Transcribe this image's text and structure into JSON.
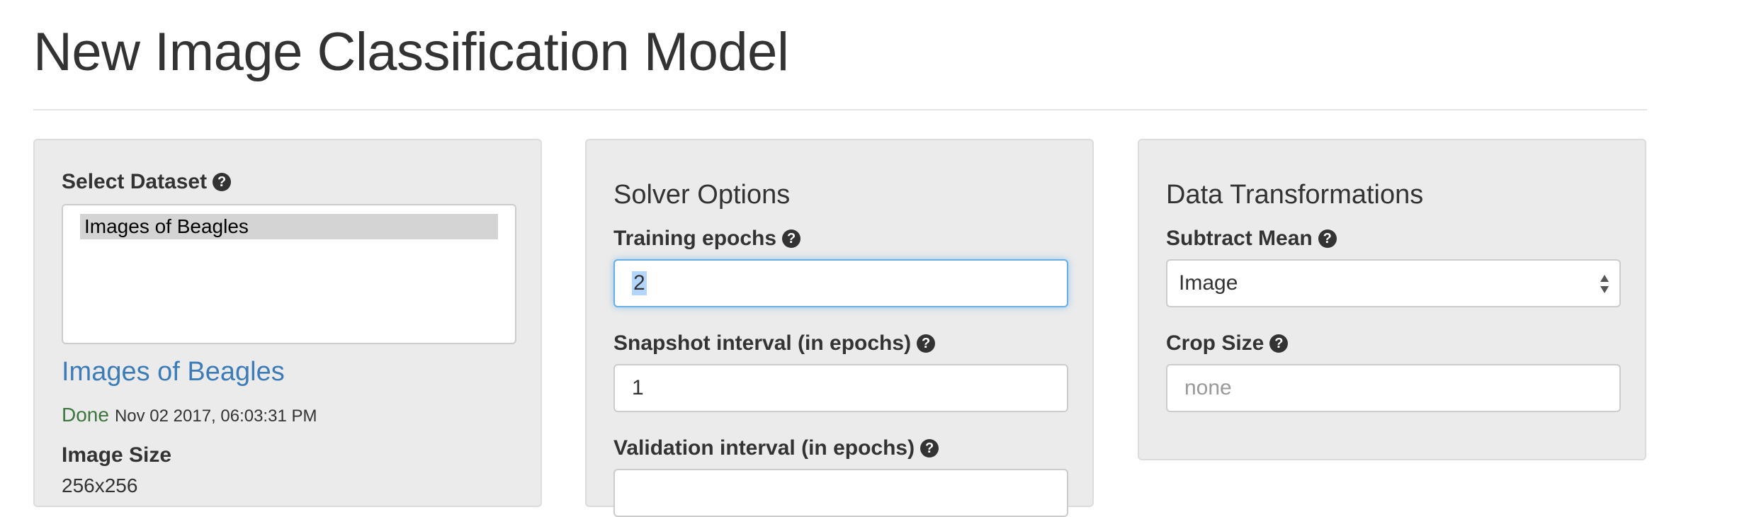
{
  "page": {
    "title": "New Image Classification Model"
  },
  "dataset_panel": {
    "select_label": "Select Dataset",
    "options": [
      "Images of Beagles"
    ],
    "selected_name": "Images of Beagles",
    "status": "Done",
    "timestamp": "Nov 02 2017, 06:03:31 PM",
    "image_size_label": "Image Size",
    "image_size_value": "256x256"
  },
  "solver_panel": {
    "heading": "Solver Options",
    "training_epochs_label": "Training epochs",
    "training_epochs_value": "2",
    "snapshot_label": "Snapshot interval (in epochs)",
    "snapshot_value": "1",
    "validation_label": "Validation interval (in epochs)"
  },
  "transform_panel": {
    "heading": "Data Transformations",
    "subtract_mean_label": "Subtract Mean",
    "subtract_mean_value": "Image",
    "crop_size_label": "Crop Size",
    "crop_size_placeholder": "none"
  },
  "icons": {
    "help": "question-circle-icon",
    "select_arrows": "sort-arrows-icon"
  },
  "colors": {
    "link": "#3c7cb8",
    "done": "#3c763d",
    "focus": "#66afe9",
    "selection": "#b4d5fe"
  }
}
